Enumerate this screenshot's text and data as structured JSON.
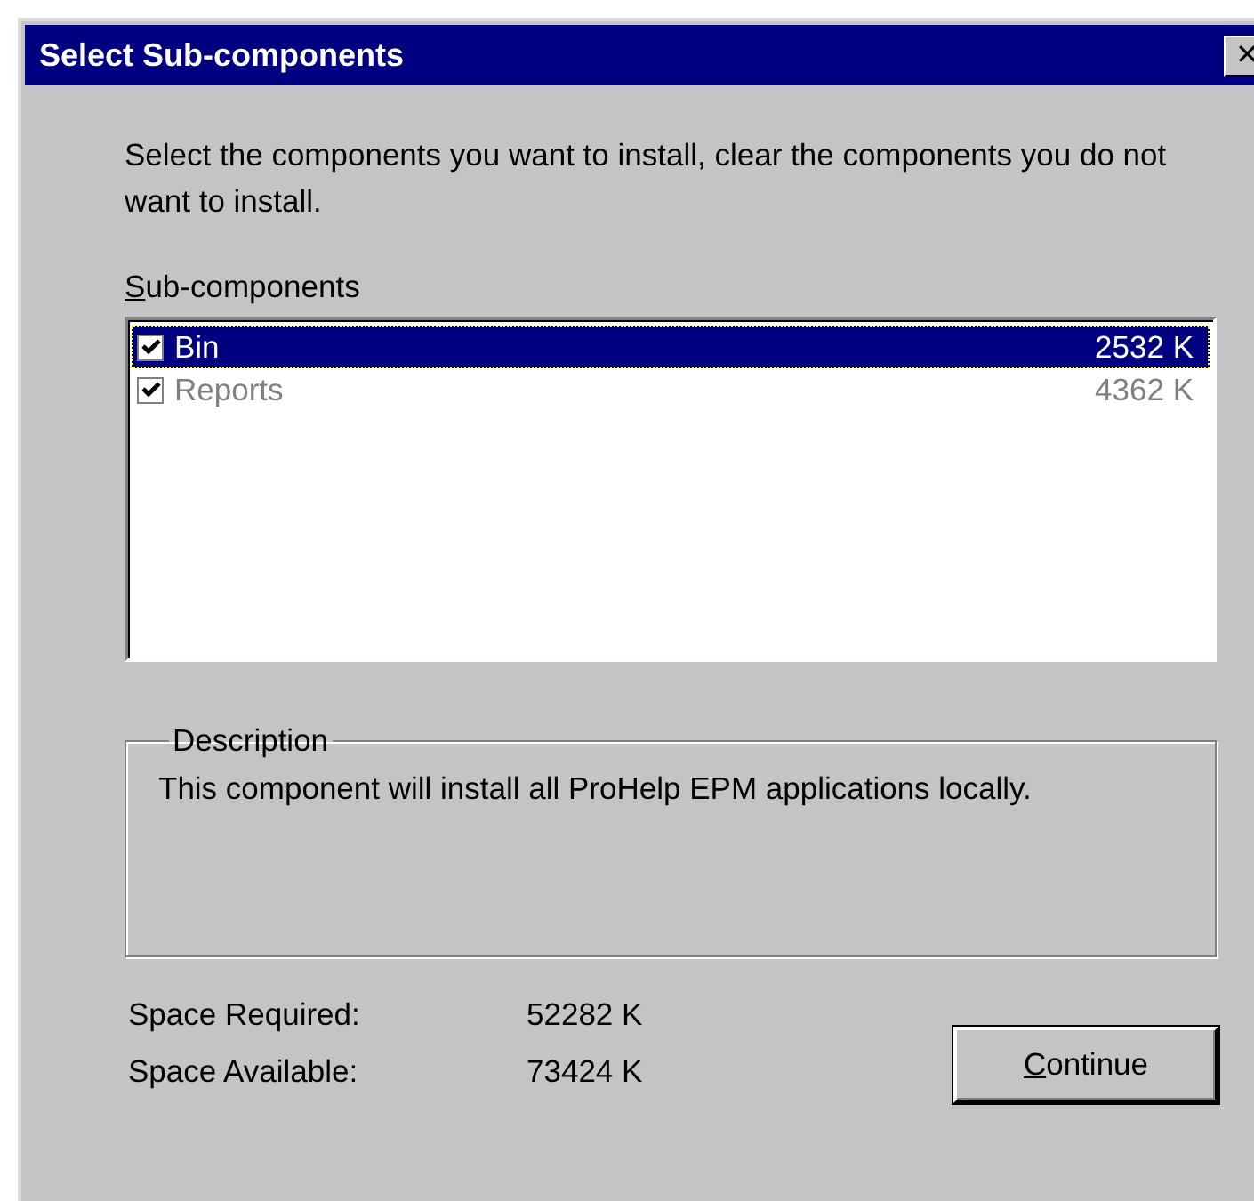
{
  "window": {
    "title": "Select Sub-components",
    "close": "✕"
  },
  "instructions": "Select the components you want to install, clear the components you do not want to install.",
  "list_label": "Sub-components",
  "components": [
    {
      "name": "Bin",
      "size": "2532 K",
      "checked": true,
      "selected": true,
      "disabled": false
    },
    {
      "name": "Reports",
      "size": "4362 K",
      "checked": true,
      "selected": false,
      "disabled": true
    }
  ],
  "description": {
    "title": "Description",
    "text": "This component will install all ProHelp EPM applications locally."
  },
  "space": [
    {
      "label": "Space Required:",
      "value": "52282 K"
    },
    {
      "label": "Space Available:",
      "value": "73424 K"
    }
  ],
  "buttons": [
    "Continue"
  ]
}
